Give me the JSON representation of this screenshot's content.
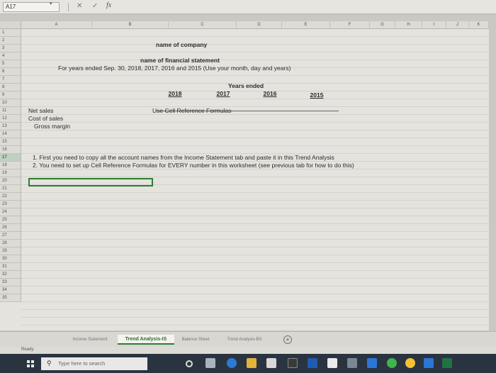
{
  "formula_bar": {
    "name_box": "A17",
    "cancel_icon": "✕",
    "enter_icon": "✓",
    "fx_label": "fx"
  },
  "columns": [
    "A",
    "B",
    "C",
    "D",
    "E",
    "F",
    "G",
    "H",
    "I",
    "J",
    "K"
  ],
  "rows": [
    "1",
    "2",
    "3",
    "4",
    "5",
    "6",
    "7",
    "8",
    "9",
    "10",
    "11",
    "12",
    "13",
    "14",
    "15",
    "16",
    "17",
    "18",
    "19",
    "20",
    "21",
    "22",
    "23",
    "24",
    "25",
    "26",
    "27",
    "28",
    "29",
    "30",
    "31",
    "32",
    "33",
    "34",
    "35"
  ],
  "content": {
    "company": "name of company",
    "statement": "name of financial statement",
    "period": "For years ended Sep. 30, 2018, 2017, 2016 and 2015 (Use your month, day and years)",
    "years_header": "Years ended",
    "years": [
      "2018",
      "2017",
      "2016",
      "2015"
    ],
    "net_sales": "Net sales",
    "cost_of_sales": "Cost of sales",
    "gross_margin": "Gross margin",
    "hint": "Use Cell Reference Formulas",
    "instruction_1": "1. First you need to copy all the account names from the Income Statement tab and paste it in this Trend Analysis",
    "instruction_2": "2. You need to set up Cell Reference Formulas for EVERY number in this worksheet (see previous tab for how to do this)"
  },
  "tabs": [
    {
      "label": "Income Statement",
      "active": false
    },
    {
      "label": "Trend Analysis-IS",
      "active": true
    },
    {
      "label": "Balance Sheet",
      "active": false
    },
    {
      "label": "Trend Analysis-BS",
      "active": false
    }
  ],
  "status": "Ready",
  "taskbar": {
    "search_placeholder": "Type here to search"
  },
  "colors": {
    "accent": "#2e7d32",
    "taskbar": "#2a3440"
  }
}
